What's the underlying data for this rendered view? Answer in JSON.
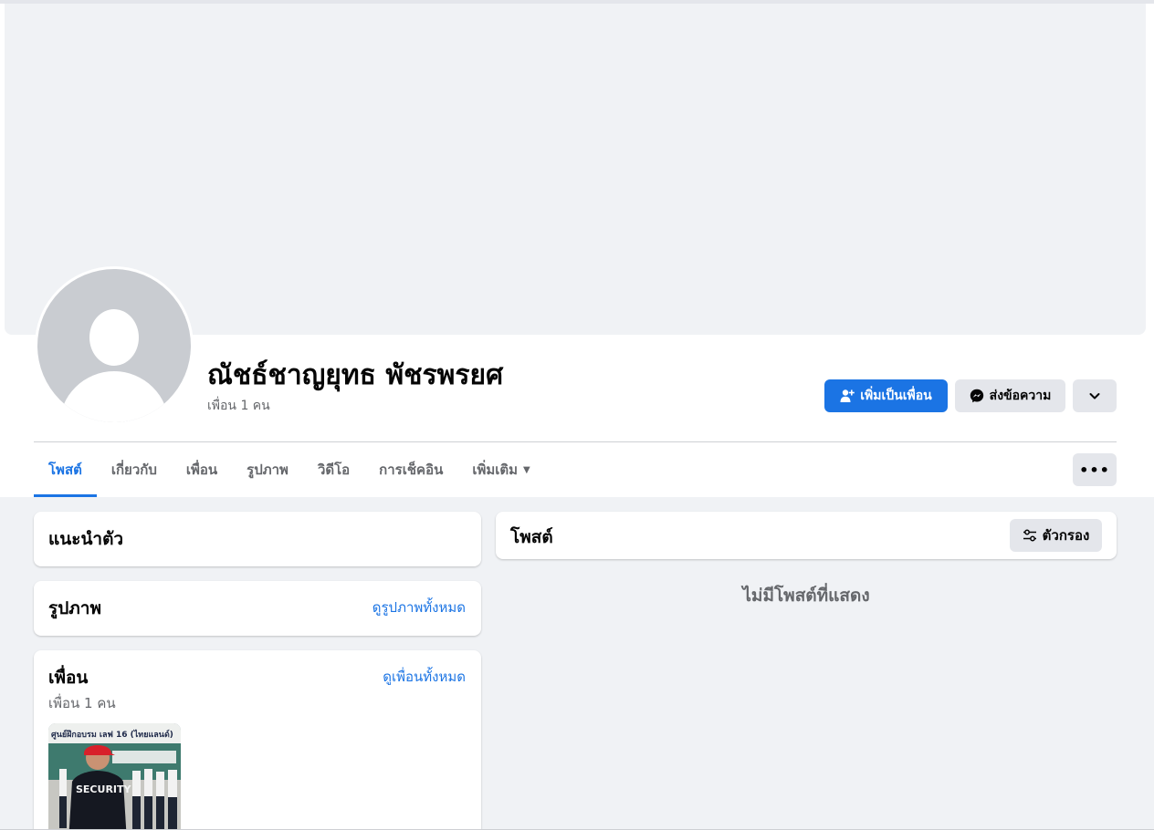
{
  "profile": {
    "name": "ณัชธ์ชาญยุทธ พัชรพรยศ",
    "friend_count": "เพื่อน 1 คน"
  },
  "actions": {
    "add_friend": "เพิ่มเป็นเพื่อน",
    "message": "ส่งข้อความ"
  },
  "tabs": [
    {
      "label": "โพสต์",
      "active": true
    },
    {
      "label": "เกี่ยวกับ"
    },
    {
      "label": "เพื่อน"
    },
    {
      "label": "รูปภาพ"
    },
    {
      "label": "วิดีโอ"
    },
    {
      "label": "การเช็คอิน"
    },
    {
      "label": "เพิ่มเติม"
    }
  ],
  "intro": {
    "title": "แนะนำตัว"
  },
  "photos": {
    "title": "รูปภาพ",
    "see_all": "ดูรูปภาพทั้งหมด"
  },
  "friends": {
    "title": "เพื่อน",
    "see_all": "ดูเพื่อนทั้งหมด",
    "count": "เพื่อน 1 คน",
    "photo_sign": "ศูนย์ฝึกอบรม เลฟ 16 (ไทยแลนด์)",
    "photo_shirt": "SECURITY"
  },
  "posts": {
    "title": "โพสต์",
    "filter": "ตัวกรอง",
    "empty": "ไม่มีโพสต์ที่แสดง"
  },
  "colors": {
    "accent": "#1b74e4",
    "background": "#f0f2f5",
    "secondary_button": "#e4e6eb",
    "muted_text": "#65676b"
  }
}
